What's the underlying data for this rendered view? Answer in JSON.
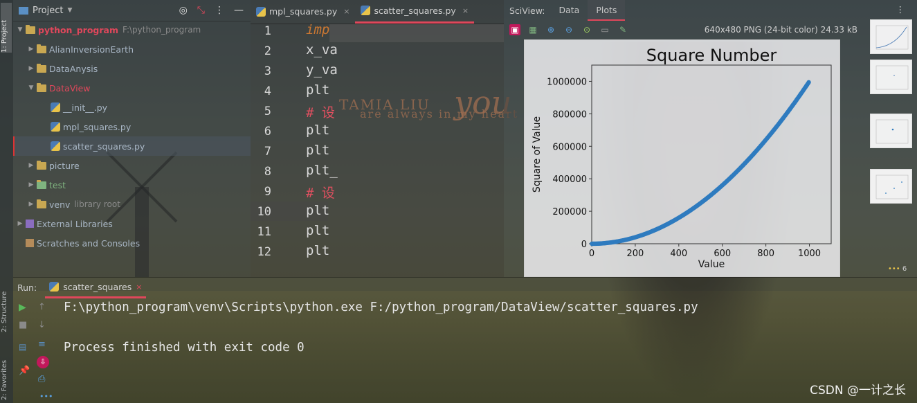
{
  "stripe": {
    "project_label": "1: Project",
    "structure_label": "2: Structure",
    "favorites_label": "2: Favorites"
  },
  "project": {
    "title": "Project",
    "items": [
      {
        "label": "python_program",
        "sub": "F:\\python_program"
      },
      {
        "label": "AlianInversionEarth"
      },
      {
        "label": "DataAnysis"
      },
      {
        "label": "DataView"
      },
      {
        "label": "__init__.py"
      },
      {
        "label": "mpl_squares.py"
      },
      {
        "label": "scatter_squares.py"
      },
      {
        "label": "picture"
      },
      {
        "label": "test"
      },
      {
        "label": "venv",
        "sub": "library root"
      },
      {
        "label": "External Libraries"
      },
      {
        "label": "Scratches and Consoles"
      }
    ]
  },
  "editor": {
    "tabs": [
      "mpl_squares.py",
      "scatter_squares.py"
    ],
    "line_numbers": [
      "1",
      "2",
      "3",
      "4",
      "5",
      "6",
      "7",
      "8",
      "9",
      "10",
      "11",
      "12"
    ],
    "lines": [
      "imp",
      "x_va",
      "y_va",
      "plt",
      "# 设",
      "plt",
      "plt",
      "plt_",
      "# 设",
      "plt",
      "plt",
      "plt"
    ]
  },
  "sciview": {
    "label": "SciView:",
    "tabs": [
      "Data",
      "Plots"
    ],
    "info": "640x480 PNG (24-bit color) 24.33 kB",
    "more_count": "6"
  },
  "chart_data": {
    "type": "scatter",
    "title": "Square Number",
    "xlabel": "Value",
    "ylabel": "Square of Value",
    "xlim": [
      0,
      1100
    ],
    "ylim": [
      0,
      1100000
    ],
    "x_ticks": [
      0,
      200,
      400,
      600,
      800,
      1000
    ],
    "y_ticks": [
      0,
      200000,
      400000,
      600000,
      800000,
      1000000
    ],
    "x_tick_labels": [
      "0",
      "200",
      "400",
      "600",
      "800",
      "1000"
    ],
    "y_tick_labels": [
      "0",
      "200000",
      "400000",
      "600000",
      "800000",
      "1000000"
    ],
    "function": "y = x^2",
    "x_range": [
      1,
      1000
    ],
    "color": "#2e7bbf"
  },
  "background": {
    "text1": "TAMIA LIU",
    "text2": "are always in my heart",
    "text3": "you"
  },
  "run": {
    "label": "Run:",
    "tab": "scatter_squares",
    "console": [
      "F:\\python_program\\venv\\Scripts\\python.exe F:/python_program/DataView/scatter_squares.py",
      "",
      "Process finished with exit code 0"
    ]
  },
  "watermark": "CSDN @一计之长"
}
